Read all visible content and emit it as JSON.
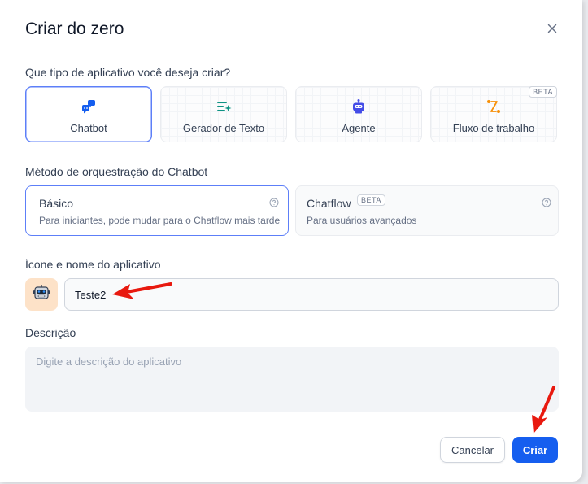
{
  "dialog": {
    "title": "Criar do zero",
    "close_icon": "close-icon"
  },
  "app_type": {
    "question": "Que tipo de aplicativo você deseja criar?",
    "options": [
      {
        "label": "Chatbot",
        "icon": "chatbot-icon",
        "color": "#155eef",
        "selected": true
      },
      {
        "label": "Gerador de Texto",
        "icon": "text-generator-icon",
        "color": "#0e9384"
      },
      {
        "label": "Agente",
        "icon": "agent-robot-icon",
        "color": "#444ce7"
      },
      {
        "label": "Fluxo de trabalho",
        "icon": "workflow-icon",
        "color": "#f79009",
        "badge": "BETA"
      }
    ]
  },
  "orchestration": {
    "label": "Método de orquestração do Chatbot",
    "options": [
      {
        "title": "Básico",
        "subtitle": "Para iniciantes, pode mudar para o Chatflow mais tarde",
        "selected": true
      },
      {
        "title": "Chatflow",
        "badge": "BETA",
        "subtitle": "Para usuários avançados"
      }
    ]
  },
  "app_name": {
    "label": "Ícone e nome do aplicativo",
    "value": "Teste2",
    "avatar_icon": "robot-face-emoji"
  },
  "description": {
    "label": "Descrição",
    "placeholder": "Digite a descrição do aplicativo"
  },
  "footer": {
    "cancel_label": "Cancelar",
    "create_label": "Criar"
  },
  "colors": {
    "accent": "#155eef",
    "selected_border": "#5d7ff8",
    "annotation_arrow": "#e8190f"
  }
}
